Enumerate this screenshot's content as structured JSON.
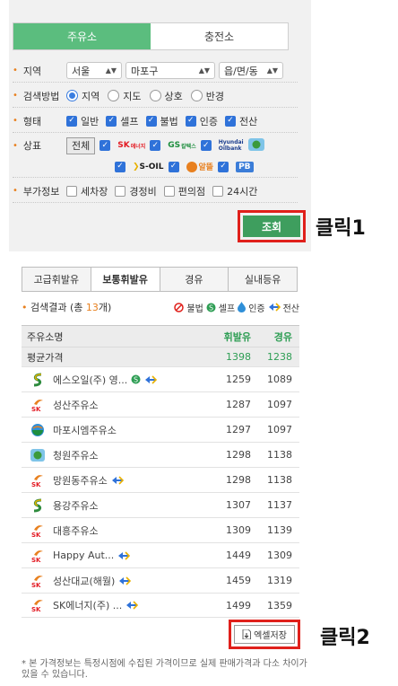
{
  "station_tabs": [
    {
      "label": "주유소",
      "active": true
    },
    {
      "label": "충전소",
      "active": false
    }
  ],
  "region": {
    "label": "지역",
    "sido": "서울",
    "sigungu": "마포구",
    "dong_placeholder": "읍/면/동"
  },
  "search_method": {
    "label": "검색방법",
    "options": [
      {
        "label": "지역",
        "selected": true
      },
      {
        "label": "지도",
        "selected": false
      },
      {
        "label": "상호",
        "selected": false
      },
      {
        "label": "반경",
        "selected": false
      }
    ]
  },
  "type_filter": {
    "label": "형태",
    "options": [
      {
        "label": "일반",
        "checked": true
      },
      {
        "label": "셀프",
        "checked": true
      },
      {
        "label": "불법",
        "checked": true
      },
      {
        "label": "인증",
        "checked": true
      },
      {
        "label": "전산",
        "checked": true
      }
    ]
  },
  "brand_filter": {
    "label": "상표",
    "all_label": "전체",
    "brands": [
      {
        "mark": "SK",
        "text": "에너지",
        "color": "#e31b23"
      },
      {
        "mark": "GS",
        "text": "칼텍스",
        "color": "#1e8e3e"
      },
      {
        "mark": "Hyundai",
        "text": "Oilbank",
        "color": "#1d3f8f"
      },
      {
        "mark": "S-OIL",
        "text": "",
        "color": "#1b1b1b"
      },
      {
        "mark": "알뜰",
        "text": "",
        "color": "#e8801f"
      },
      {
        "mark": "PB",
        "text": "",
        "color": "#3b7dd8"
      }
    ]
  },
  "extra_info": {
    "label": "부가정보",
    "options": [
      {
        "label": "세차장",
        "checked": false
      },
      {
        "label": "경정비",
        "checked": false
      },
      {
        "label": "편의점",
        "checked": false
      },
      {
        "label": "24시간",
        "checked": false
      }
    ]
  },
  "lookup_button": "조회",
  "annotation_1": "클릭1",
  "fuel_tabs": [
    {
      "label": "고급휘발유",
      "active": false
    },
    {
      "label": "보통휘발유",
      "active": true
    },
    {
      "label": "경유",
      "active": false
    },
    {
      "label": "실내등유",
      "active": false
    }
  ],
  "results_summary": {
    "prefix": "검색결과 (총 ",
    "count": "13",
    "suffix": "개)"
  },
  "legend": {
    "illegal": "불법",
    "self": "셀프",
    "certified": "인증",
    "computerized": "전산"
  },
  "table": {
    "header": {
      "name": "주유소명",
      "col1": "휘발유",
      "col2": "경유"
    },
    "average": {
      "name": "평균가격",
      "col1": "1398",
      "col2": "1238"
    },
    "rows": [
      {
        "brand": "soil",
        "name": "에스오일(주) 영...",
        "self": true,
        "computer": true,
        "col1": "1259",
        "col2": "1089"
      },
      {
        "brand": "sk",
        "name": "성산주유소",
        "self": false,
        "computer": false,
        "col1": "1287",
        "col2": "1097"
      },
      {
        "brand": "gs",
        "name": "마포시엠주유소",
        "self": false,
        "computer": false,
        "col1": "1297",
        "col2": "1097"
      },
      {
        "brand": "hd",
        "name": "청원주유소",
        "self": false,
        "computer": false,
        "col1": "1298",
        "col2": "1138"
      },
      {
        "brand": "sk",
        "name": "망원동주유소",
        "self": false,
        "computer": true,
        "col1": "1298",
        "col2": "1138"
      },
      {
        "brand": "soil",
        "name": "용강주유소",
        "self": false,
        "computer": false,
        "col1": "1307",
        "col2": "1137"
      },
      {
        "brand": "sk",
        "name": "대흥주유소",
        "self": false,
        "computer": false,
        "col1": "1309",
        "col2": "1139"
      },
      {
        "brand": "sk",
        "name": "Happy Aut...",
        "self": false,
        "computer": true,
        "col1": "1449",
        "col2": "1309"
      },
      {
        "brand": "sk",
        "name": "성산대교(해월)",
        "self": false,
        "computer": true,
        "col1": "1459",
        "col2": "1319"
      },
      {
        "brand": "sk",
        "name": "SK에너지(주) ...",
        "self": false,
        "computer": true,
        "col1": "1499",
        "col2": "1359"
      }
    ]
  },
  "export_button": "엑셀저장",
  "annotation_2": "클릭2",
  "notice": "* 본 가격정보는 특정시점에 수집된 가격이므로 실제 판매가격과 다소 차이가 있을 수 있습니다.",
  "colors": {
    "green_tab": "#5bbd7e",
    "green_button": "#3e9e5e",
    "price_green": "#2e9e54",
    "highlight_red": "#e0201b",
    "accent_orange": "#e8801f"
  }
}
